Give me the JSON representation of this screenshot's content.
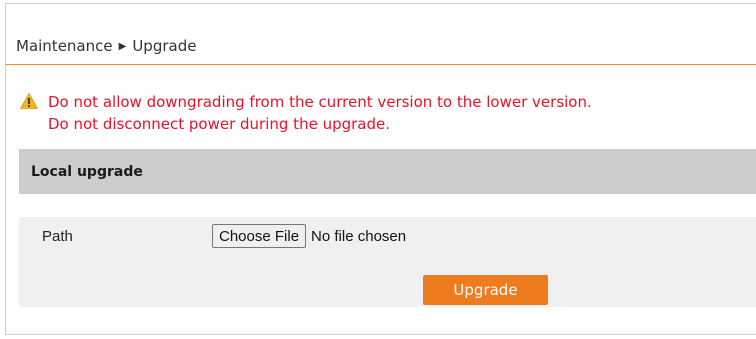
{
  "breadcrumb": {
    "parent": "Maintenance",
    "separator": "▶",
    "current": "Upgrade"
  },
  "warning": {
    "icon": "warning-triangle-icon",
    "line1": "Do not allow downgrading from the current version to the lower version.",
    "line2": "Do not disconnect power during the upgrade."
  },
  "section": {
    "title": "Local upgrade"
  },
  "form": {
    "path_label": "Path",
    "choose_file_label": "Choose File",
    "file_status": "No file chosen",
    "upgrade_label": "Upgrade"
  },
  "colors": {
    "accent": "#ef7b1f",
    "warning_text": "#e8122a",
    "section_header_bg": "#cccccc",
    "form_bg": "#f0f0f0"
  }
}
